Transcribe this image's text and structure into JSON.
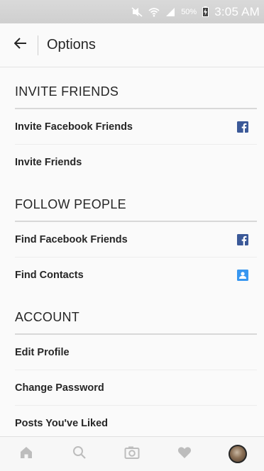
{
  "status_bar": {
    "battery_percent": "50%",
    "time": "3:05 AM",
    "icons": [
      "mute-icon",
      "wifi-icon",
      "signal-icon",
      "battery-charging-icon"
    ]
  },
  "header": {
    "title": "Options",
    "back_icon": "back-arrow-icon"
  },
  "sections": [
    {
      "title": "INVITE FRIENDS",
      "items": [
        {
          "label": "Invite Facebook Friends",
          "icon": "facebook-icon"
        },
        {
          "label": "Invite Friends",
          "icon": null
        }
      ]
    },
    {
      "title": "FOLLOW PEOPLE",
      "items": [
        {
          "label": "Find Facebook Friends",
          "icon": "facebook-icon"
        },
        {
          "label": "Find Contacts",
          "icon": "contacts-icon"
        }
      ]
    },
    {
      "title": "ACCOUNT",
      "items": [
        {
          "label": "Edit Profile",
          "icon": null
        },
        {
          "label": "Change Password",
          "icon": null
        },
        {
          "label": "Posts You've Liked",
          "icon": null
        }
      ]
    }
  ],
  "bottom_nav": {
    "items": [
      "home-icon",
      "search-icon",
      "camera-icon",
      "heart-icon",
      "profile-avatar"
    ]
  },
  "colors": {
    "facebook_blue": "#3b5998",
    "contacts_blue": "#3897f0",
    "nav_icon_gray": "#bdbdbd",
    "text": "#262626"
  }
}
